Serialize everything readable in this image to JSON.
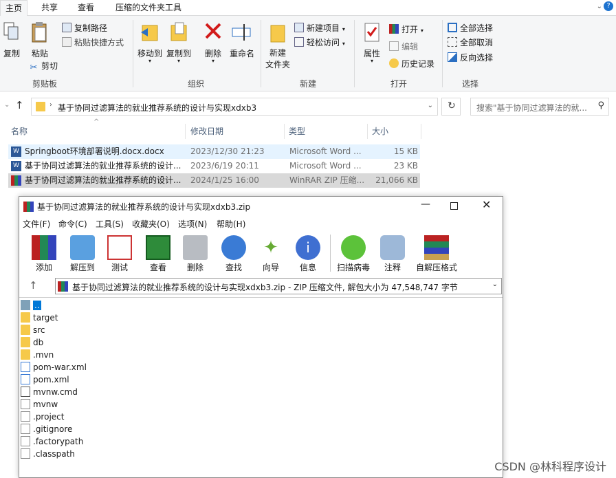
{
  "ribbon_tabs": [
    "主页",
    "共享",
    "查看",
    "压缩的文件夹工具"
  ],
  "ribbon": {
    "clipboard": {
      "title": "剪贴板",
      "copy": "复制",
      "paste": "粘贴",
      "copy_path": "复制路径",
      "paste_shortcut": "粘贴快捷方式",
      "cut": "剪切"
    },
    "organize": {
      "title": "组织",
      "move_to": "移动到",
      "copy_to": "复制到",
      "delete": "删除",
      "rename": "重命名"
    },
    "new": {
      "title": "新建",
      "new_folder": "新建\n文件夹",
      "new_item": "新建项目",
      "easy_access": "轻松访问"
    },
    "open": {
      "title": "打开",
      "properties": "属性",
      "open": "打开",
      "edit": "编辑",
      "history": "历史记录"
    },
    "select": {
      "title": "选择",
      "select_all": "全部选择",
      "select_none": "全部取消",
      "invert": "反向选择"
    }
  },
  "address": {
    "path": "基于协同过滤算法的就业推荐系统的设计与实现xdxb3",
    "search_placeholder": "搜索\"基于协同过滤算法的就..."
  },
  "columns": {
    "name": "名称",
    "date": "修改日期",
    "type": "类型",
    "size": "大小"
  },
  "files": [
    {
      "name": "Springboot环境部署说明.docx.docx",
      "date": "2023/12/30 21:23",
      "type": "Microsoft Word ...",
      "size": "15 KB",
      "icon": "word-icon"
    },
    {
      "name": "基于协同过滤算法的就业推荐系统的设计...",
      "date": "2023/6/19 20:11",
      "type": "Microsoft Word ...",
      "size": "23 KB",
      "icon": "word-icon"
    },
    {
      "name": "基于协同过滤算法的就业推荐系统的设计...",
      "date": "2024/1/25 16:00",
      "type": "WinRAR ZIP 压缩...",
      "size": "21,066 KB",
      "icon": "winrar-icon"
    }
  ],
  "winrar": {
    "title": "基于协同过滤算法的就业推荐系统的设计与实现xdxb3.zip",
    "menu": [
      "文件(F)",
      "命令(C)",
      "工具(S)",
      "收藏夹(O)",
      "选项(N)",
      "帮助(H)"
    ],
    "tools": [
      "添加",
      "解压到",
      "测试",
      "查看",
      "删除",
      "查找",
      "向导",
      "信息",
      "扫描病毒",
      "注释",
      "自解压格式"
    ],
    "path": "基于协同过滤算法的就业推荐系统的设计与实现xdxb3.zip - ZIP 压缩文件, 解包大小为 47,548,747 字节",
    "entries": [
      {
        "name": "..",
        "kind": "up"
      },
      {
        "name": "target",
        "kind": "folder"
      },
      {
        "name": "src",
        "kind": "folder"
      },
      {
        "name": "db",
        "kind": "folder"
      },
      {
        "name": ".mvn",
        "kind": "folder"
      },
      {
        "name": "pom-war.xml",
        "kind": "xml"
      },
      {
        "name": "pom.xml",
        "kind": "xml"
      },
      {
        "name": "mvnw.cmd",
        "kind": "cmd"
      },
      {
        "name": "mvnw",
        "kind": "file"
      },
      {
        "name": ".project",
        "kind": "file"
      },
      {
        "name": ".gitignore",
        "kind": "file"
      },
      {
        "name": ".factorypath",
        "kind": "file"
      },
      {
        "name": ".classpath",
        "kind": "file"
      }
    ]
  },
  "watermark": "CSDN @林科程序设计",
  "colors": {
    "accent": "#0078d7",
    "selected_row": "#cce8ff",
    "selected_row_gray": "#d9d9d9",
    "folder": "#f6c94a"
  }
}
